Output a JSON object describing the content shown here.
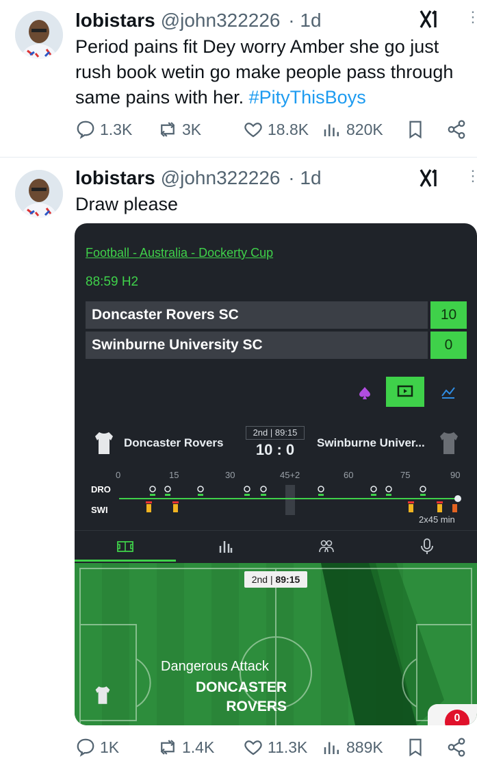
{
  "tweet1": {
    "name": "lobistars",
    "handle": "@john322226",
    "time": "· 1d",
    "brand": "x1",
    "text_before_tag": "Period pains fit Dey worry Amber she go just rush book wetin go make people pass through same pains with her.",
    "hashtag": "#PityThisBoys",
    "replies": "1.3K",
    "reposts": "3K",
    "likes": "18.8K",
    "views": "820K"
  },
  "tweet2": {
    "name": "lobistars",
    "handle": "@john322226",
    "time": "· 1d",
    "brand": "x1",
    "text": "Draw please",
    "replies": "1K",
    "reposts": "1.4K",
    "likes": "11.3K",
    "views": "889K"
  },
  "card": {
    "competition": "Football - Australia - Dockerty Cup",
    "clock": "88:59 H2",
    "home_team": "Doncaster Rovers SC",
    "away_team": "Swinburne University SC",
    "home_score": "10",
    "away_score": "0",
    "mid_home": "Doncaster Rovers",
    "mid_away": "Swinburne Univer...",
    "period_label": "2nd | 89:15",
    "score_line": "10 : 0",
    "timeline_minutes": [
      "0",
      "15",
      "30",
      "45+2",
      "60",
      "75",
      "90"
    ],
    "row_home": "DRO",
    "row_away": "SWI",
    "duration": "2x45 min",
    "pitch_period": "2nd",
    "pitch_time": "89:15",
    "attack_label": "Dangerous Attack",
    "attack_team": "DONCASTER ROVERS",
    "badge_count": "0",
    "colors": {
      "accent": "#3fd14a",
      "card_bg": "#1f2329",
      "pitch": "#2d8d3c",
      "link": "#1d9bf0"
    }
  }
}
